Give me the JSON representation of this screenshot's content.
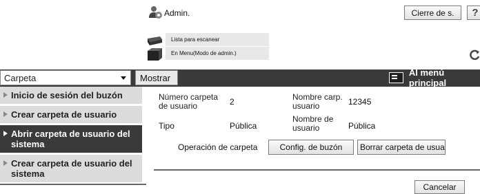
{
  "header": {
    "user_label": "Admin.",
    "logout_label": "Cierre de s.",
    "help_label": "?"
  },
  "status": {
    "scan_text": "Lista para escanear",
    "mode_text": "En Menu(Modo de admin.)"
  },
  "toolbar": {
    "select_value": "Carpeta",
    "show_label": "Mostrar",
    "main_menu_label": "Al menú principal"
  },
  "sidebar": {
    "items": [
      {
        "label": "Inicio de sesión del buzón",
        "active": false
      },
      {
        "label": "Crear carpeta de usuario",
        "active": false
      },
      {
        "label": "Abrir carpeta de usuario del sistema",
        "active": true
      },
      {
        "label": "Crear carpeta de usuario del sistema",
        "active": false
      }
    ]
  },
  "content": {
    "folder_number_label": "Número carpeta de usuario",
    "folder_number_value": "2",
    "folder_name_label": "Nombre carp. usuario",
    "folder_name_value": "12345",
    "type_label": "Tipo",
    "type_value": "Pública",
    "name_label": "Nombre de usuario",
    "name_value": "Pública",
    "operation_label": "Operación de carpeta",
    "config_button": "Config. de buzón",
    "delete_button": "Borrar carpeta de usuar",
    "cancel_button": "Cancelar"
  }
}
